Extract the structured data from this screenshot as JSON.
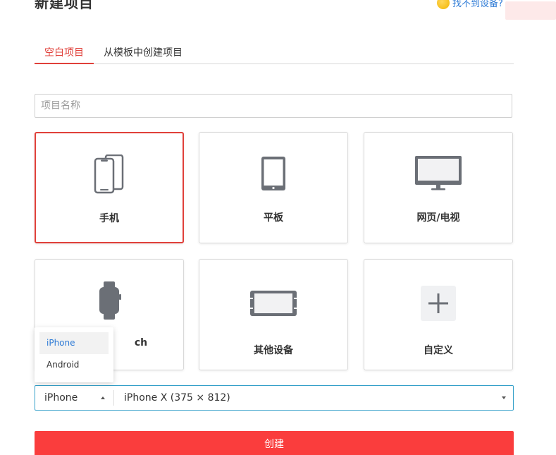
{
  "modal": {
    "title": "新建项目",
    "help_link": "找不到设备?"
  },
  "tabs": [
    {
      "label": "空白项目",
      "active": true
    },
    {
      "label": "从模板中创建项目",
      "active": false
    }
  ],
  "name_input": {
    "placeholder": "项目名称",
    "value": ""
  },
  "devices": [
    {
      "label": "手机",
      "icon": "phones-icon",
      "selected": true
    },
    {
      "label": "平板",
      "icon": "tablet-icon",
      "selected": false
    },
    {
      "label": "网页/电视",
      "icon": "monitor-icon",
      "selected": false
    },
    {
      "label": "ch",
      "icon": "watch-icon",
      "selected": false
    },
    {
      "label": "其他设备",
      "icon": "other-device-icon",
      "selected": false
    },
    {
      "label": "自定义",
      "icon": "plus-icon",
      "selected": false
    }
  ],
  "os_dropdown": {
    "options": [
      "iPhone",
      "Android"
    ],
    "highlighted": "iPhone"
  },
  "selector": {
    "os_value": "iPhone",
    "model_value": "iPhone X (375 × 812)"
  },
  "create_button": {
    "label": "创建"
  },
  "colors": {
    "accent_red": "#e0403a",
    "button_red": "#fa3d3d",
    "link_blue": "#2e7bd6",
    "focus_border": "#35a0c9",
    "icon_gray": "#6b6f76"
  }
}
